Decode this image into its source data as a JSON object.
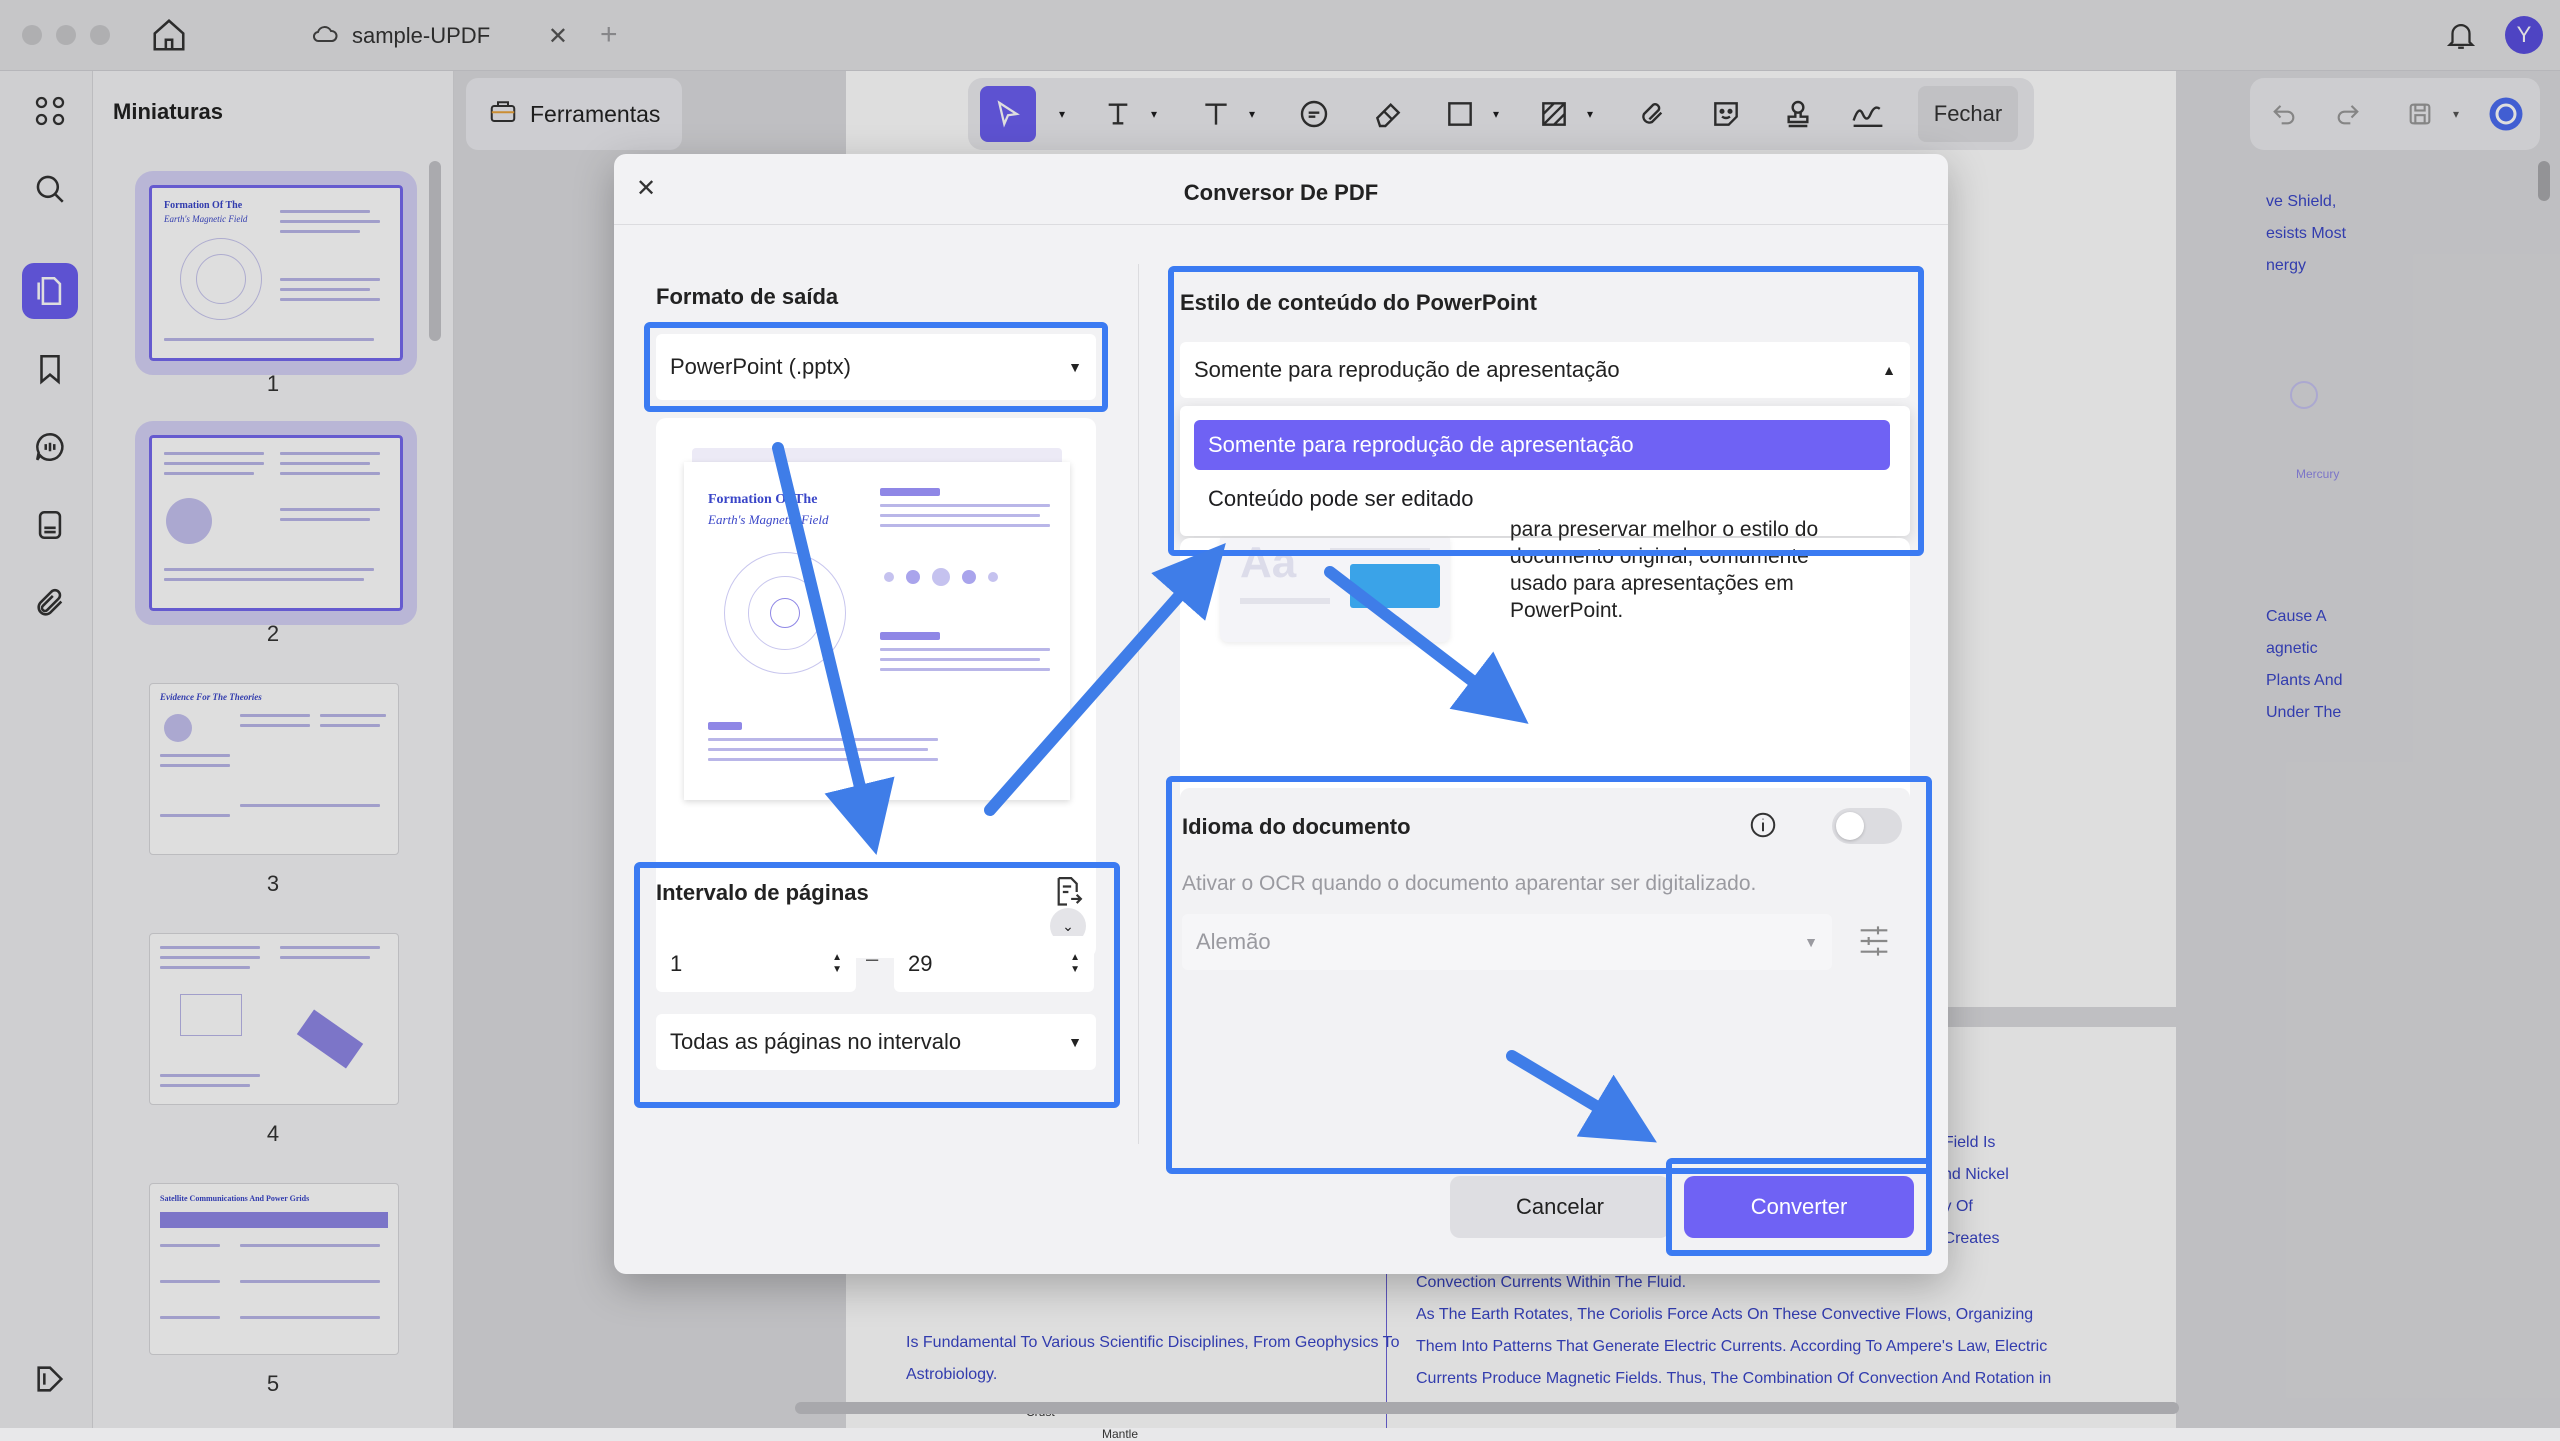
{
  "window": {
    "tab_title": "sample-UPDF",
    "avatar_letter": "Y"
  },
  "sidebar": {
    "panel_title": "Miniaturas",
    "thumbnails": [
      {
        "page": "1",
        "heading": "Formation Of The",
        "subheading": "Earth's Magnetic Field"
      },
      {
        "page": "2"
      },
      {
        "page": "3",
        "heading": "Evidence For The Theories"
      },
      {
        "page": "4"
      },
      {
        "page": "5",
        "heading": "Satellite Communications And Power Grids"
      }
    ]
  },
  "toolbar": {
    "tools_label": "Ferramentas",
    "close_label": "Fechar"
  },
  "document": {
    "right_col_top": [
      "ve Shield,",
      "esists Most",
      "nergy"
    ],
    "right_col_mid": [
      "Cause A",
      "agnetic",
      "Plants And",
      "Under The"
    ],
    "axis_label": "Mercury",
    "page2_right": [
      "s Magnetic Field Is",
      "olten Iron And Nickel",
      "y The Decay Of",
      ". This Heat Creates"
    ],
    "page2_bottom": [
      "Convection Currents Within The Fluid.",
      "As The Earth Rotates, The Coriolis Force Acts On These Convective Flows, Organizing",
      "Them Into Patterns That Generate Electric Currents. According To Ampere's Law, Electric",
      "Currents Produce Magnetic Fields. Thus, The Combination Of Convection And Rotation in"
    ],
    "page2_left": [
      "Is Fundamental To Various Scientific Disciplines, From Geophysics To",
      "Astrobiology."
    ],
    "diagram_labels": [
      "Crust",
      "Mantle"
    ]
  },
  "dialog": {
    "title": "Conversor De PDF",
    "output_format": {
      "label": "Formato de saída",
      "value": "PowerPoint (.pptx)"
    },
    "preview": {
      "heading": "Formation Of The",
      "subheading": "Earth's Magnetic Field"
    },
    "page_range": {
      "label": "Intervalo de páginas",
      "from": "1",
      "dash": "–",
      "to": "29",
      "mode": "Todas as páginas no intervalo"
    },
    "content_style": {
      "label": "Estilo de conteúdo do PowerPoint",
      "value": "Somente para reprodução de apresentação",
      "options": [
        "Somente para reprodução de apresentação",
        "Conteúdo pode ser editado"
      ],
      "description": [
        "para preservar melhor o estilo do",
        "documento original, comumente",
        "usado para apresentações em",
        "PowerPoint."
      ]
    },
    "language": {
      "label": "Idioma do documento",
      "hint": "Ativar o OCR quando o documento aparentar ser digitalizado.",
      "value": "Alemão",
      "ocr_enabled": false
    },
    "buttons": {
      "cancel": "Cancelar",
      "convert": "Converter"
    }
  },
  "colors": {
    "accent": "#6f62f4",
    "highlight": "#3b7bf2",
    "arrow": "#3f7de8"
  }
}
